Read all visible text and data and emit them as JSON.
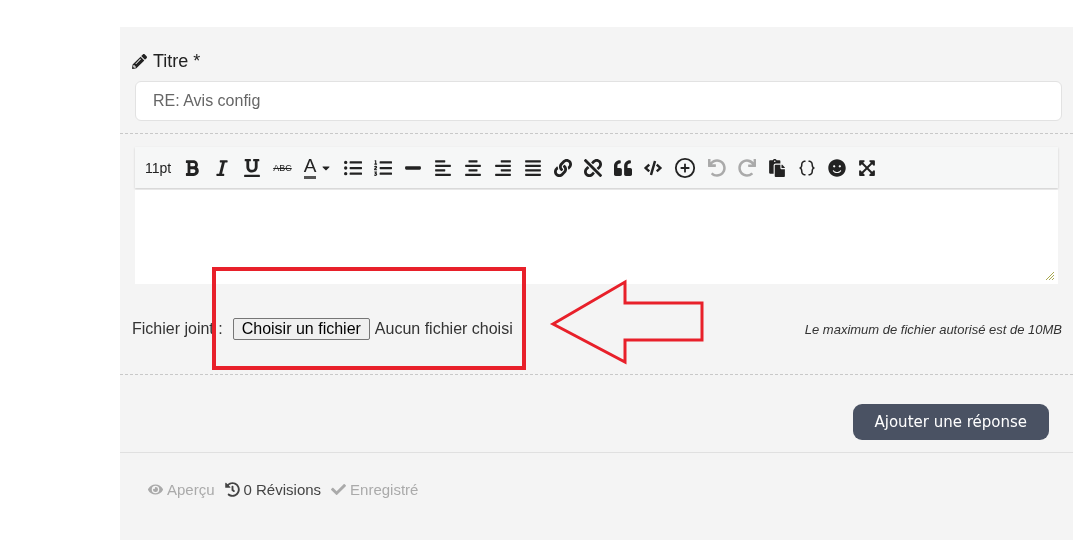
{
  "title_field": {
    "label": "Titre *",
    "value": "RE: Avis config"
  },
  "toolbar": {
    "font_size": "11pt",
    "strike_label": "ABC",
    "color_label": "A",
    "tools": [
      {
        "disabled": false
      },
      {
        "disabled": false
      },
      {
        "disabled": false
      },
      {
        "disabled": false
      },
      {
        "disabled": false
      },
      {
        "disabled": false
      },
      {
        "disabled": false
      },
      {
        "disabled": false
      },
      {
        "disabled": false
      },
      {
        "disabled": false
      },
      {
        "disabled": false
      },
      {
        "disabled": false
      },
      {
        "disabled": false
      },
      {
        "disabled": false
      },
      {
        "disabled": false
      },
      {
        "disabled": true
      },
      {
        "disabled": true
      },
      {
        "disabled": false
      },
      {
        "disabled": false
      },
      {
        "disabled": false
      },
      {
        "disabled": false
      }
    ]
  },
  "attachment": {
    "label": "Fichier joint :",
    "button": "Choisir un fichier",
    "status": "Aucun fichier choisi",
    "note": "Le maximum de fichier autorisé est de 10MB"
  },
  "submit": "Ajouter une réponse",
  "footer": [
    {
      "label": "Aperçu",
      "disabled": true
    },
    {
      "label": "0 Révisions",
      "disabled": false
    },
    {
      "label": "Enregistré",
      "disabled": true
    }
  ]
}
